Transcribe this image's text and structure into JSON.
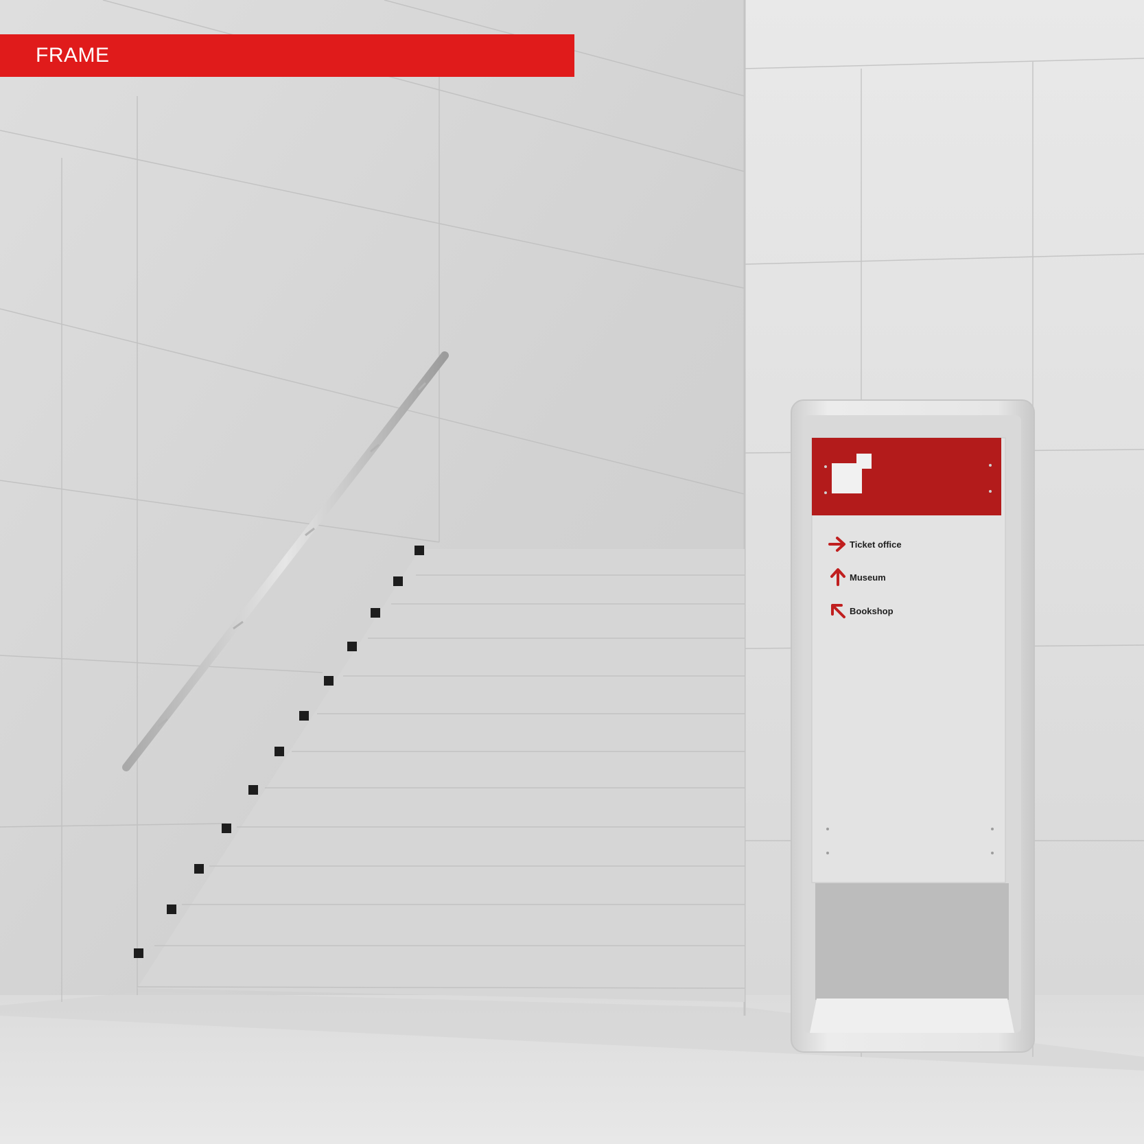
{
  "banner": {
    "label": "FRAME",
    "color": "#e01b1b"
  },
  "sign": {
    "header_color": "#b31b1b",
    "header_caption": "",
    "items": [
      {
        "label": "Ticket office",
        "icon": "arrow-right-icon"
      },
      {
        "label": "Museum",
        "icon": "arrow-up-icon"
      },
      {
        "label": "Bookshop",
        "icon": "arrow-up-left-icon"
      }
    ]
  }
}
